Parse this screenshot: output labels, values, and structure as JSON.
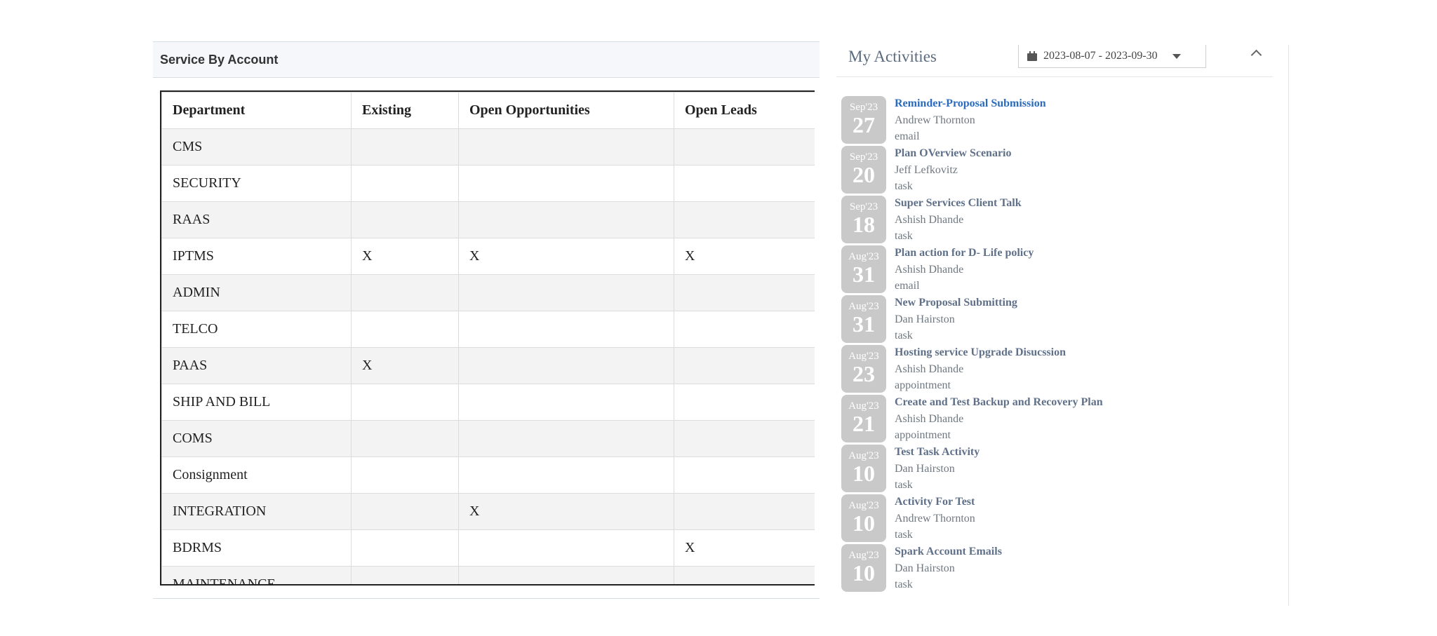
{
  "service_panel": {
    "title": "Service By Account",
    "columns": [
      "Department",
      "Existing",
      "Open Opportunities",
      "Open Leads"
    ],
    "rows": [
      [
        "CMS",
        "",
        "",
        ""
      ],
      [
        "SECURITY",
        "",
        "",
        ""
      ],
      [
        "RAAS",
        "",
        "",
        ""
      ],
      [
        "IPTMS",
        "X",
        "X",
        "X"
      ],
      [
        "ADMIN",
        "",
        "",
        ""
      ],
      [
        "TELCO",
        "",
        "",
        ""
      ],
      [
        "PAAS",
        "X",
        "",
        ""
      ],
      [
        "SHIP AND BILL",
        "",
        "",
        ""
      ],
      [
        "COMS",
        "",
        "",
        ""
      ],
      [
        "Consignment",
        "",
        "",
        ""
      ],
      [
        "INTEGRATION",
        "",
        "X",
        ""
      ],
      [
        "BDRMS",
        "",
        "",
        "X"
      ],
      [
        "MAINTENANCE",
        "",
        "",
        ""
      ]
    ]
  },
  "activities_panel": {
    "title": "My Activities",
    "date_range": "2023-08-07 - 2023-09-30",
    "items": [
      {
        "month": "Sep'23",
        "day": "27",
        "subject": "Reminder-Proposal Submission",
        "person": "Andrew Thornton",
        "type": "email",
        "highlight": true
      },
      {
        "month": "Sep'23",
        "day": "20",
        "subject": "Plan OVerview Scenario",
        "person": "Jeff Lefkovitz",
        "type": "task"
      },
      {
        "month": "Sep'23",
        "day": "18",
        "subject": "Super Services Client Talk",
        "person": "Ashish Dhande",
        "type": "task"
      },
      {
        "month": "Aug'23",
        "day": "31",
        "subject": "Plan action for D- Life policy",
        "person": "Ashish Dhande",
        "type": "email"
      },
      {
        "month": "Aug'23",
        "day": "31",
        "subject": "New Proposal Submitting",
        "person": "Dan Hairston",
        "type": "task"
      },
      {
        "month": "Aug'23",
        "day": "23",
        "subject": "Hosting service Upgrade Disucssion",
        "person": "Ashish Dhande",
        "type": "appointment"
      },
      {
        "month": "Aug'23",
        "day": "21",
        "subject": "Create and Test Backup and Recovery Plan",
        "person": "Ashish Dhande",
        "type": "appointment"
      },
      {
        "month": "Aug'23",
        "day": "10",
        "subject": "Test Task Activity",
        "person": "Dan Hairston",
        "type": "task"
      },
      {
        "month": "Aug'23",
        "day": "10",
        "subject": "Activity For Test",
        "person": "Andrew Thornton",
        "type": "task"
      },
      {
        "month": "Aug'23",
        "day": "10",
        "subject": "Spark Account Emails",
        "person": "Dan Hairston",
        "type": "task"
      }
    ]
  },
  "icons": {
    "date_picker": "calendar-icon",
    "dropdown": "caret-down-icon",
    "collapse": "chevron-up-icon"
  }
}
